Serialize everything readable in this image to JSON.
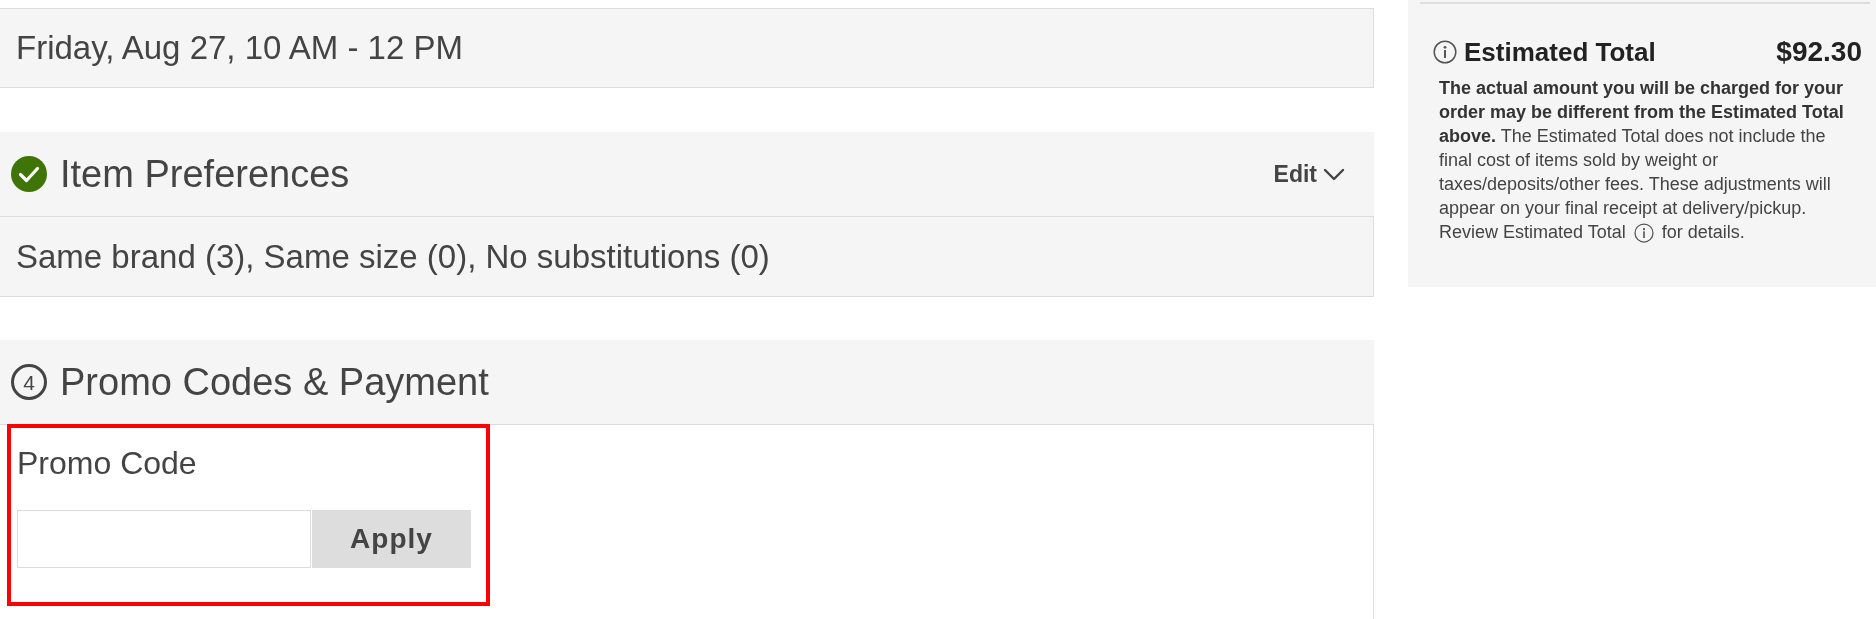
{
  "delivery_window": {
    "text": "Friday, Aug 27, 10 AM - 12 PM"
  },
  "sections": [
    {
      "title": "Item Preferences",
      "completed": true,
      "action": {
        "label": "Edit",
        "expanded": false
      },
      "summary": "Same brand (3), Same size (0), No substitutions (0)"
    },
    {
      "title": "Promo Codes & Payment",
      "completed": false,
      "step": "4",
      "promo": {
        "label": "Promo Code",
        "button": "Apply",
        "highlighted": true
      }
    }
  ],
  "order_summary": {
    "title": "Estimated Total",
    "amount": "$92.30",
    "note": "**The actual amount you will be charged for your order may be different from the Estimated Total above.** The Estimated Total does not include the final cost of items sold by weight or taxes/deposits/other fees. These adjustments will appear on your final receipt at delivery/pickup. Review Estimated Total",
    "note_end": "for details."
  }
}
